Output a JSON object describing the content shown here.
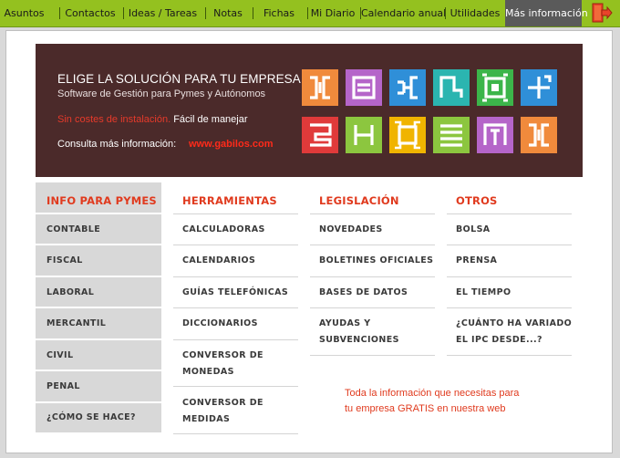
{
  "nav": {
    "items": [
      "Asuntos",
      "Contactos",
      "Ideas / Tareas",
      "Notas",
      "Fichas",
      "Mi Diario",
      "Calendario anual",
      "Utilidades",
      "Más información"
    ],
    "active": "Más información",
    "exit_icon": "exit-door-icon"
  },
  "banner": {
    "title": "ELIGE LA SOLUCIÓN PARA TU EMPRESA",
    "subtitle": "Software de Gestión para Pymes y Autónomos",
    "no_cost": "Sin costes de instalación.",
    "easy": "Fácil de manejar",
    "consult": "Consulta más información:",
    "url": "www.gabilos.com",
    "tile_colors": [
      "#f08a3c",
      "#b565c9",
      "#2f8fd8",
      "#2bb5b0",
      "#3cb54a",
      "#2f8fd8",
      "#e03a3a",
      "#8cc63f",
      "#f0b400",
      "#8cc63f",
      "#b565c9",
      "#f08a3c"
    ]
  },
  "columns": {
    "info": {
      "title": "INFO PARA PYMES",
      "items": [
        "CONTABLE",
        "FISCAL",
        "LABORAL",
        "MERCANTIL",
        "CIVIL",
        "PENAL",
        "¿CÓMO SE HACE?"
      ]
    },
    "tools": {
      "title": "HERRAMIENTAS",
      "items": [
        "CALCULADORAS",
        "CALENDARIOS",
        "GUÍAS TELEFÓNICAS",
        "DICCIONARIOS"
      ],
      "item5_line1": "CONVERSOR DE",
      "item5_line2": "MONEDAS",
      "item6_line1": "CONVERSOR DE",
      "item6_line2": "MEDIDAS"
    },
    "law": {
      "title": "LEGISLACIÓN",
      "items": [
        "NOVEDADES",
        "BOLETINES OFICIALES",
        "BASES DE DATOS"
      ],
      "item4_line1": "AYUDAS Y",
      "item4_line2": "SUBVENCIONES"
    },
    "other": {
      "title": "OTROS",
      "items": [
        "BOLSA",
        "PRENSA",
        "EL TIEMPO"
      ],
      "item4_line1": "¿CUÁNTO HA VARIADO",
      "item4_line2": "EL IPC DESDE...?"
    }
  },
  "note": {
    "line1": "Toda la información que necesitas para",
    "line2": "tu empresa GRATIS en nuestra web"
  }
}
